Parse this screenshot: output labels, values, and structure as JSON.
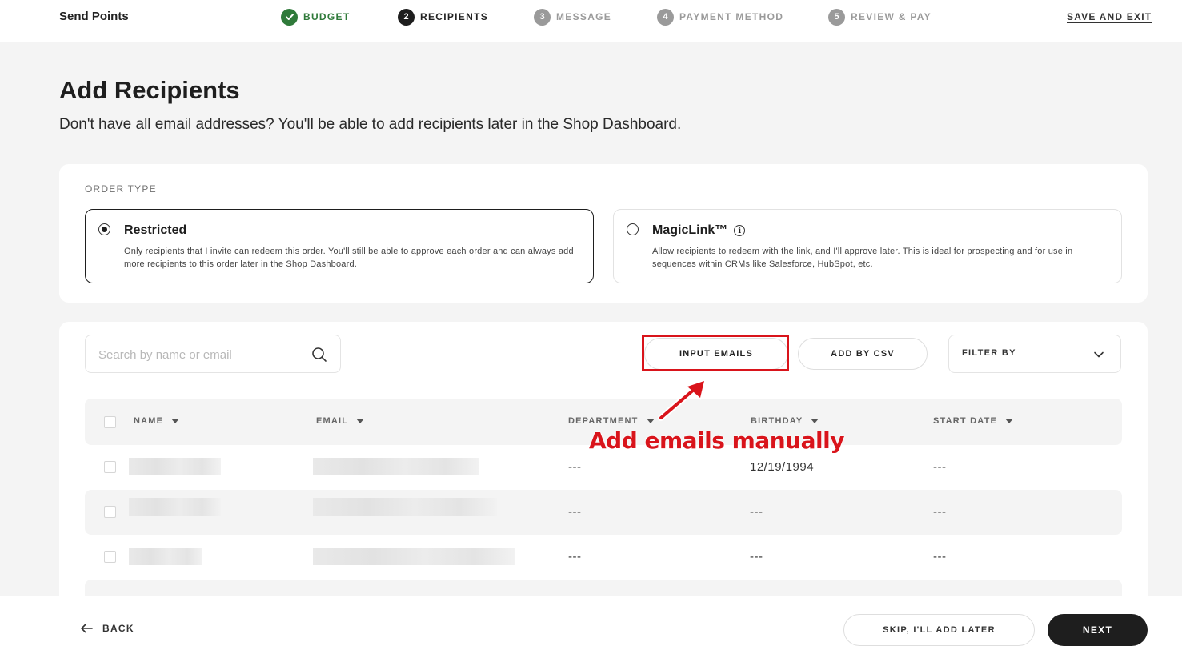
{
  "header": {
    "brand": "Send Points",
    "steps": [
      {
        "number": "",
        "label": "BUDGET",
        "status": "done",
        "icon": "check-icon"
      },
      {
        "number": "2",
        "label": "RECIPIENTS",
        "status": "current"
      },
      {
        "number": "3",
        "label": "MESSAGE",
        "status": "upcoming"
      },
      {
        "number": "4",
        "label": "PAYMENT METHOD",
        "status": "upcoming"
      },
      {
        "number": "5",
        "label": "REVIEW & PAY",
        "status": "upcoming"
      }
    ],
    "save_exit": "SAVE AND EXIT"
  },
  "page": {
    "title": "Add Recipients",
    "subtitle": "Don't have all email addresses? You'll be able to add recipients later in the Shop Dashboard."
  },
  "order_type": {
    "label": "ORDER TYPE",
    "options": [
      {
        "title": "Restricted",
        "description": "Only recipients that I invite can redeem this order. You'll still be able to approve each order and can always add more recipients to this order later in the Shop Dashboard.",
        "selected": true
      },
      {
        "title": "MagicLink™",
        "description": "Allow recipients to redeem with the link, and I'll approve later. This is ideal for prospecting and for use in sequences within CRMs like Salesforce, HubSpot, etc.",
        "selected": false,
        "info_icon": "info-icon"
      }
    ]
  },
  "toolbar": {
    "search_placeholder": "Search by name or email",
    "input_emails": "INPUT EMAILS",
    "add_by_csv": "ADD BY CSV",
    "filter_by": "FILTER BY"
  },
  "table": {
    "columns": [
      "NAME",
      "EMAIL",
      "DEPARTMENT",
      "BIRTHDAY",
      "START DATE"
    ],
    "rows": [
      {
        "department": "---",
        "birthday": "12/19/1994",
        "start_date": "---"
      },
      {
        "department": "---",
        "birthday": "---",
        "start_date": "---"
      },
      {
        "department": "---",
        "birthday": "---",
        "start_date": "---"
      }
    ]
  },
  "annotation": {
    "text": "Add emails manually",
    "color": "#d9141b"
  },
  "footer": {
    "back": "BACK",
    "skip": "SKIP, I'LL ADD LATER",
    "next": "NEXT"
  },
  "colors": {
    "success": "#2f7a3a",
    "primary": "#1e1e1e",
    "muted": "#9a9a9a"
  }
}
